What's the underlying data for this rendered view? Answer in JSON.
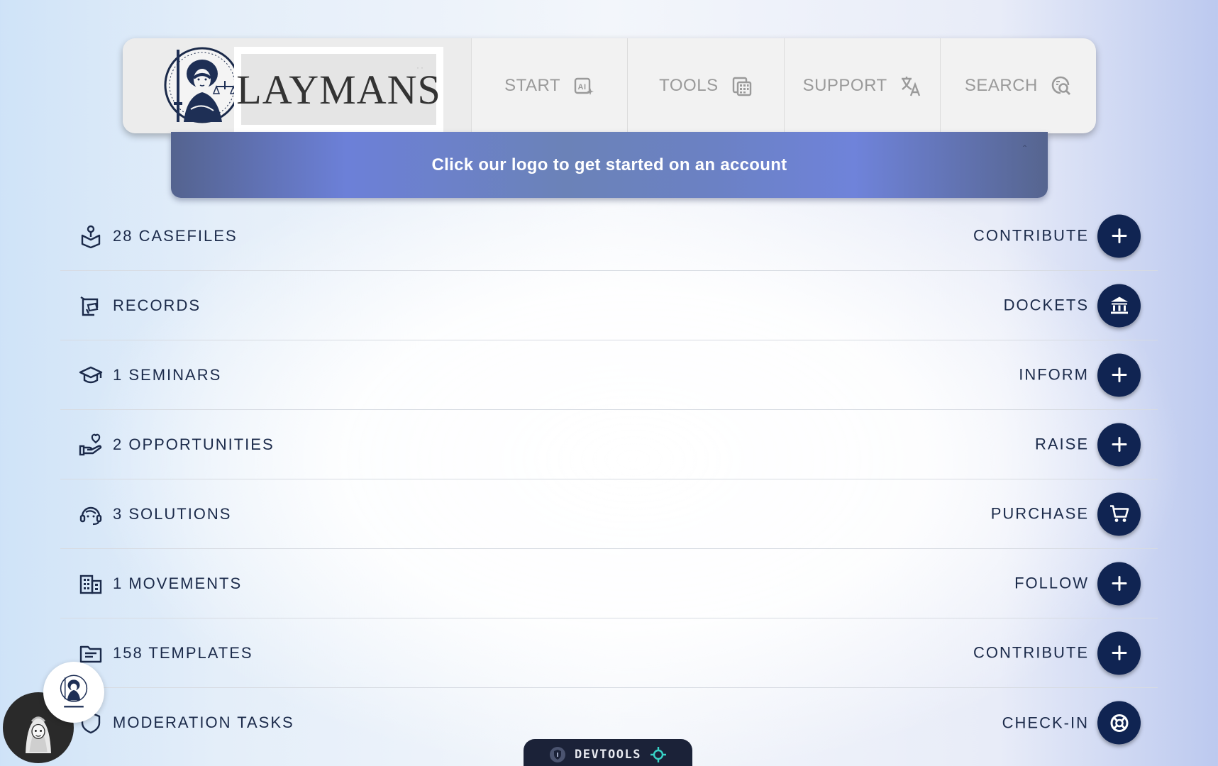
{
  "header": {
    "logo_text": "LAYMANS",
    "nav": [
      {
        "label": "START",
        "icon": "ai-sparkle-icon"
      },
      {
        "label": "TOOLS",
        "icon": "calculator-icon"
      },
      {
        "label": "SUPPORT",
        "icon": "translate-icon"
      },
      {
        "label": "SEARCH",
        "icon": "search-doc-icon"
      }
    ]
  },
  "banner": {
    "message": "Click our logo to get started on an account"
  },
  "rows": [
    {
      "label": "28 CASEFILES",
      "action": "CONTRIBUTE",
      "icon": "case-box-icon",
      "button_icon": "plus-icon"
    },
    {
      "label": "RECORDS",
      "action": "DOCKETS",
      "icon": "records-icon",
      "button_icon": "bank-icon"
    },
    {
      "label": "1 SEMINARS",
      "action": "INFORM",
      "icon": "graduation-cap-icon",
      "button_icon": "plus-icon"
    },
    {
      "label": "2 OPPORTUNITIES",
      "action": "RAISE",
      "icon": "hand-heart-icon",
      "button_icon": "plus-icon"
    },
    {
      "label": "3 SOLUTIONS",
      "action": "PURCHASE",
      "icon": "support-agent-icon",
      "button_icon": "cart-icon"
    },
    {
      "label": "1 MOVEMENTS",
      "action": "FOLLOW",
      "icon": "building-icon",
      "button_icon": "plus-icon"
    },
    {
      "label": "158 TEMPLATES",
      "action": "CONTRIBUTE",
      "icon": "folder-icon",
      "button_icon": "plus-icon"
    },
    {
      "label": "MODERATION TASKS",
      "action": "CHECK-IN",
      "icon": "shield-icon",
      "button_icon": "lifebuoy-icon"
    }
  ],
  "devtools": {
    "label": "DEVTOOLS"
  },
  "colors": {
    "button_bg": "#102452",
    "text_dark": "#1b2a4a",
    "nav_text": "#9a9a9a",
    "banner_mid": "#6c80d8"
  }
}
